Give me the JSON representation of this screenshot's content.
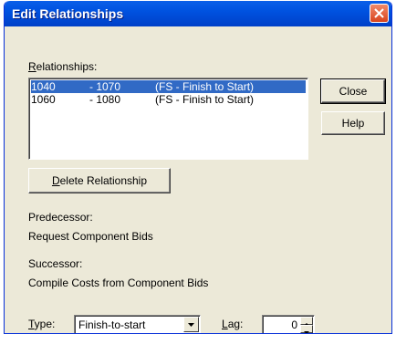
{
  "window": {
    "title": "Edit Relationships"
  },
  "relationships": {
    "label_prefix": "",
    "label_hotkey": "R",
    "label_rest": "elationships:",
    "items": [
      {
        "pred": "1040",
        "succ": "- 1070",
        "type": "(FS - Finish to Start)",
        "selected": true
      },
      {
        "pred": "1060",
        "succ": "- 1080",
        "type": "(FS - Finish to Start)",
        "selected": false
      }
    ]
  },
  "buttons": {
    "close": "Close",
    "help": "Help",
    "delete_hotkey": "D",
    "delete_rest": "elete Relationship"
  },
  "predecessor": {
    "label": "Predecessor:",
    "value": "Request Component Bids"
  },
  "successor": {
    "label": "Successor:",
    "value": "Compile Costs from Component Bids"
  },
  "type": {
    "label_hotkey": "T",
    "label_rest": "ype:",
    "value": "Finish-to-start"
  },
  "lag": {
    "label_hotkey": "L",
    "label_rest": "ag:",
    "value": "0"
  },
  "colors": {
    "titlebar": "#0052E0",
    "selection": "#316AC5",
    "dialog_bg": "#ECE9D8"
  }
}
